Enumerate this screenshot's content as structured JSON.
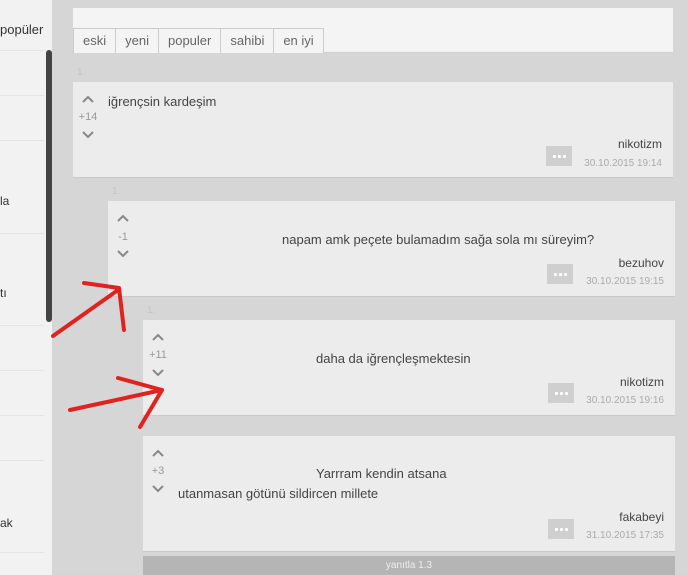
{
  "sidebar": {
    "tab_label": "popüler",
    "fragments": [
      "la",
      "tı",
      "ak"
    ]
  },
  "sort_tabs": [
    "eski",
    "yeni",
    "populer",
    "sahibi",
    "en iyi"
  ],
  "ghost_numbers": [
    "1.",
    "1.",
    "1."
  ],
  "entries": [
    {
      "score": "+14",
      "text": "iğrençsin kardeşim",
      "author": "nikotizm",
      "date": "30.10.2015 19:14"
    },
    {
      "score": "-1",
      "text": "napam amk peçete bulamadım sağa sola mı süreyim?",
      "author": "bezuhov",
      "date": "30.10.2015 19:15"
    },
    {
      "score": "+11",
      "text": "daha da iğrençleşmektesin",
      "author": "nikotizm",
      "date": "30.10.2015 19:16"
    },
    {
      "score": "+3",
      "text_line1": "Yarrram kendin atsana",
      "text_line2": "utanmasan götünü sildircen millete",
      "author": "fakabeyi",
      "date": "31.10.2015 17:35"
    }
  ],
  "reply_label": "yanıtla 1.3",
  "icons": {
    "upvote": "chevron-up-icon",
    "downvote": "chevron-down-icon",
    "more": "more-dots-icon"
  },
  "colors": {
    "annotation_red": "#e0231e"
  }
}
